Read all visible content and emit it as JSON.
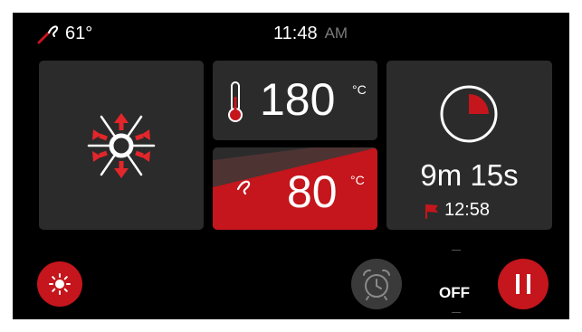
{
  "status_bar": {
    "probe_temp": "61°",
    "time": "11:48",
    "am_pm": "AM"
  },
  "oven_temp": {
    "value": "180",
    "unit": "°C"
  },
  "probe_target": {
    "value": "80",
    "unit": "°C"
  },
  "timer": {
    "remaining": "9m 15s",
    "end_time": "12:58",
    "progress": 0.25
  },
  "controls": {
    "off_label": "OFF"
  },
  "icons": {
    "probe": "probe-icon",
    "fan": "convection-fan-icon",
    "thermometer": "thermometer-icon",
    "timer": "timer-pie-icon",
    "flag": "flag-icon",
    "light": "light-icon",
    "alarm": "alarm-clock-icon",
    "pause": "pause-icon"
  },
  "colors": {
    "accent": "#c4161c",
    "tile": "#2b2b2b",
    "background": "#000000",
    "muted": "#7a7a7a"
  }
}
